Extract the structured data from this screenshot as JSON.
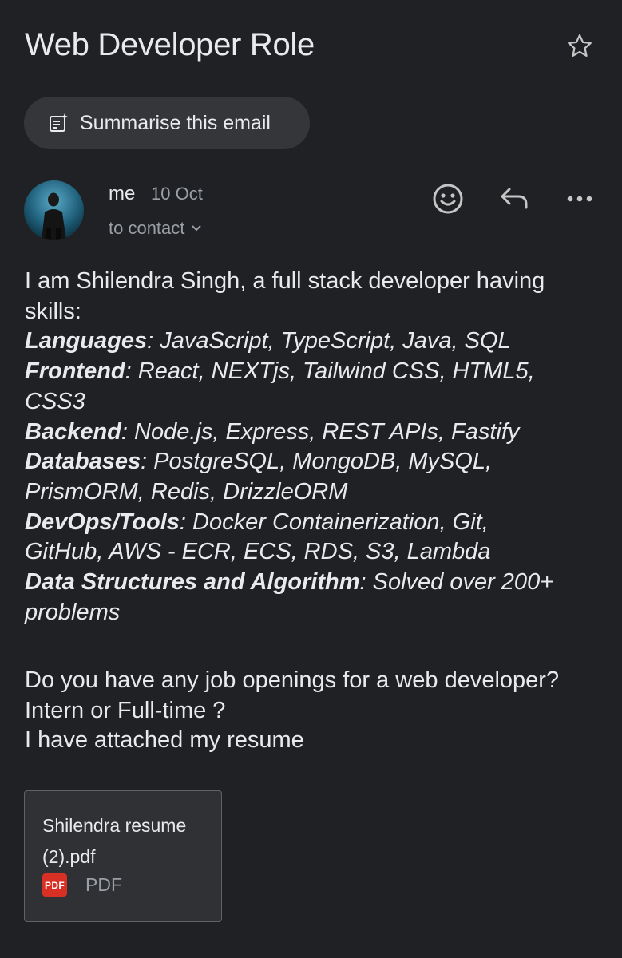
{
  "email": {
    "subject": "Web Developer Role",
    "summarise_label": "Summarise this email",
    "sender": {
      "name": "me",
      "date": "10 Oct",
      "recipients": "to contact"
    },
    "icons": {
      "star": "star-icon",
      "summarise": "summarise-icon",
      "emoji": "emoji-icon",
      "reply": "reply-icon",
      "more": "more-icon"
    },
    "body": {
      "intro": [
        "I am Shilendra Singh, a full stack developer having",
        "skills:"
      ],
      "skills": [
        {
          "label": "Languages",
          "lines": [
            "JavaScript, TypeScript, Java, SQL"
          ]
        },
        {
          "label": "Frontend",
          "lines": [
            "React, NEXTjs, Tailwind CSS, HTML5,",
            "CSS3"
          ]
        },
        {
          "label": "Backend",
          "lines": [
            "Node.js, Express, REST APIs, Fastify"
          ]
        },
        {
          "label": "Databases",
          "lines": [
            "PostgreSQL, MongoDB, MySQL,",
            "PrismORM, Redis, DrizzleORM"
          ]
        },
        {
          "label": "DevOps/Tools",
          "lines": [
            "Docker Containerization, Git,",
            "GitHub, AWS - ECR, ECS, RDS, S3, Lambda"
          ]
        },
        {
          "label": "Data Structures and Algorithm",
          "lines": [
            "Solved over 200+",
            "problems"
          ]
        }
      ],
      "question_lines": [
        "Do you have any job openings for a web developer?",
        "Intern or Full-time ?",
        "I have attached my resume"
      ]
    },
    "attachment": {
      "filename_lines": [
        "Shilendra resume",
        "(2).pdf"
      ],
      "badge": "PDF",
      "type": "PDF"
    },
    "colors": {
      "background": "#202124",
      "text": "#e8eaed",
      "muted": "#9aa0a6",
      "chip": "#35363a",
      "pdf_red": "#d93025"
    }
  }
}
